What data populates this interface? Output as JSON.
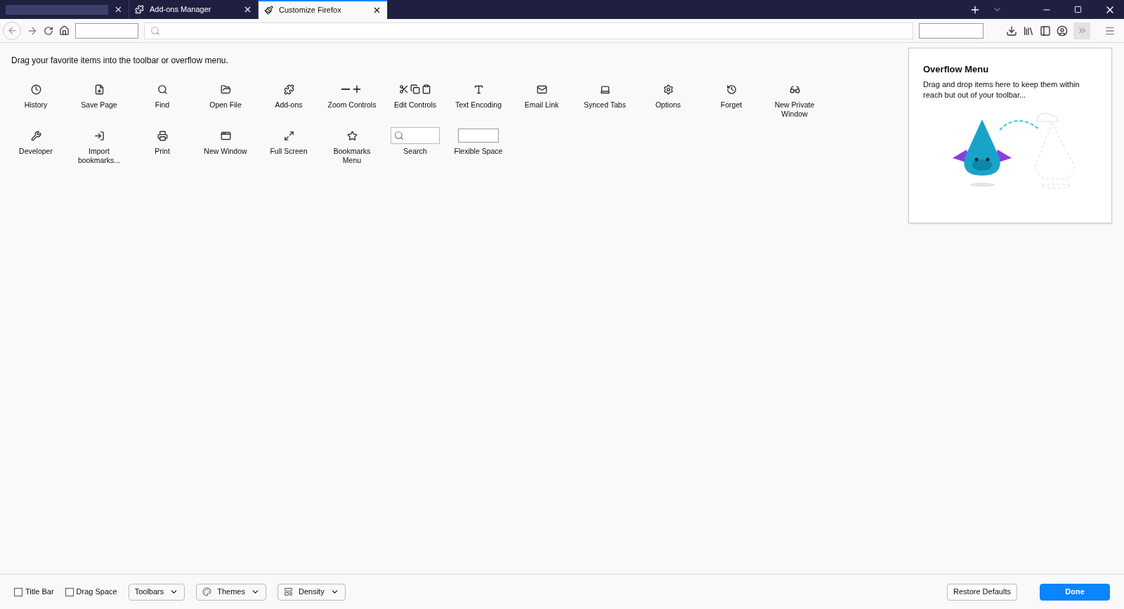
{
  "tabs": [
    {
      "kind": "blurred",
      "selected": false
    },
    {
      "label": "Add-ons Manager",
      "kind": "addons",
      "selected": false
    },
    {
      "label": "Customize Firefox",
      "kind": "customize",
      "selected": true
    }
  ],
  "instruction": "Drag your favorite items into the toolbar or overflow menu.",
  "palette_items": [
    {
      "label": "History",
      "kind": "history"
    },
    {
      "label": "Save Page",
      "kind": "save"
    },
    {
      "label": "Find",
      "kind": "find"
    },
    {
      "label": "Open File",
      "kind": "open"
    },
    {
      "label": "Add-ons",
      "kind": "addons"
    },
    {
      "label": "Zoom Controls",
      "kind": "zoom"
    },
    {
      "label": "Edit Controls",
      "kind": "edit"
    },
    {
      "label": "Text Encoding",
      "kind": "encoding"
    },
    {
      "label": "Email Link",
      "kind": "email"
    },
    {
      "label": "Synced Tabs",
      "kind": "synced"
    },
    {
      "label": "Options",
      "kind": "options"
    },
    {
      "label": "Forget",
      "kind": "forget"
    },
    {
      "label": "New Private Window",
      "kind": "private"
    },
    {
      "label": "Developer",
      "kind": "developer"
    },
    {
      "label": "Import bookmarks...",
      "kind": "import"
    },
    {
      "label": "Print",
      "kind": "print"
    },
    {
      "label": "New Window",
      "kind": "window"
    },
    {
      "label": "Full Screen",
      "kind": "fullscreen"
    },
    {
      "label": "Bookmarks Menu",
      "kind": "bookmarks"
    },
    {
      "label": "Search",
      "kind": "search-field"
    },
    {
      "label": "Flexible Space",
      "kind": "space"
    }
  ],
  "overflow_panel": {
    "title": "Overflow Menu",
    "description": "Drag and drop items here to keep them within reach but out of your toolbar..."
  },
  "footer": {
    "checkboxes": [
      {
        "label": "Title Bar",
        "checked": false
      },
      {
        "label": "Drag Space",
        "checked": false
      }
    ],
    "dropdowns": [
      {
        "label": "Toolbars",
        "kind": "plain"
      },
      {
        "label": "Themes",
        "kind": "themes"
      },
      {
        "label": "Density",
        "kind": "density"
      }
    ],
    "buttons": [
      {
        "label": "Restore Defaults",
        "kind": "secondary"
      },
      {
        "label": "Done",
        "kind": "primary"
      }
    ]
  }
}
